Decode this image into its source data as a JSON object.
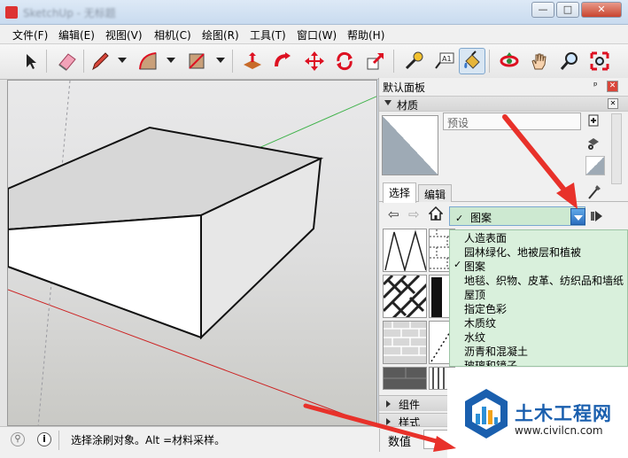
{
  "window": {
    "title": "SketchUp - 无标题",
    "minimize_label": "—",
    "maximize_label": "□",
    "close_label": "✕"
  },
  "menu": {
    "items": [
      "文件(F)",
      "编辑(E)",
      "视图(V)",
      "相机(C)",
      "绘图(R)",
      "工具(T)",
      "窗口(W)",
      "帮助(H)"
    ]
  },
  "toolbar": {
    "icons": [
      "select-arrow-icon",
      "eraser-icon",
      "pencil-line-icon",
      "arc-icon",
      "rectangle-icon",
      "push-pull-icon",
      "follow-me-icon",
      "move-icon",
      "rotate-icon",
      "scale-icon",
      "tape-measure-icon",
      "text-label-icon",
      "paint-bucket-icon",
      "orbit-icon",
      "pan-hand-icon",
      "zoom-icon",
      "zoom-extents-icon"
    ],
    "text_tool_label": "A1"
  },
  "panel": {
    "title": "默认面板",
    "pin_label": "ᵖ",
    "close_label": "✕",
    "materials_header": "材质",
    "material_name": "预设",
    "tabs": [
      "选择",
      "编辑"
    ],
    "selected_tab": "选择",
    "collection": "图案",
    "collection_options": [
      "人造表面",
      "园林绿化、地被层和植被",
      "图案",
      "地毯、织物、皮革、纺织品和墙纸",
      "屋顶",
      "指定色彩",
      "木质纹",
      "水纹",
      "沥青和混凝土",
      "玻璃和镜子"
    ],
    "checked_option": "图案",
    "collapsed_sections": [
      "组件",
      "样式"
    ]
  },
  "status": {
    "message": "选择涂刷对象。Alt =材料采样。",
    "measurements_label": "数值"
  },
  "watermark": {
    "name": "土木工程网",
    "url": "www.civilcn.com"
  },
  "colors": {
    "accent_blue": "#2d6fbf",
    "dropdown_bg": "#d9f0dc",
    "annotation_red": "#e8312a",
    "axis_green": "#3fb24a",
    "axis_red": "#cc2222"
  }
}
